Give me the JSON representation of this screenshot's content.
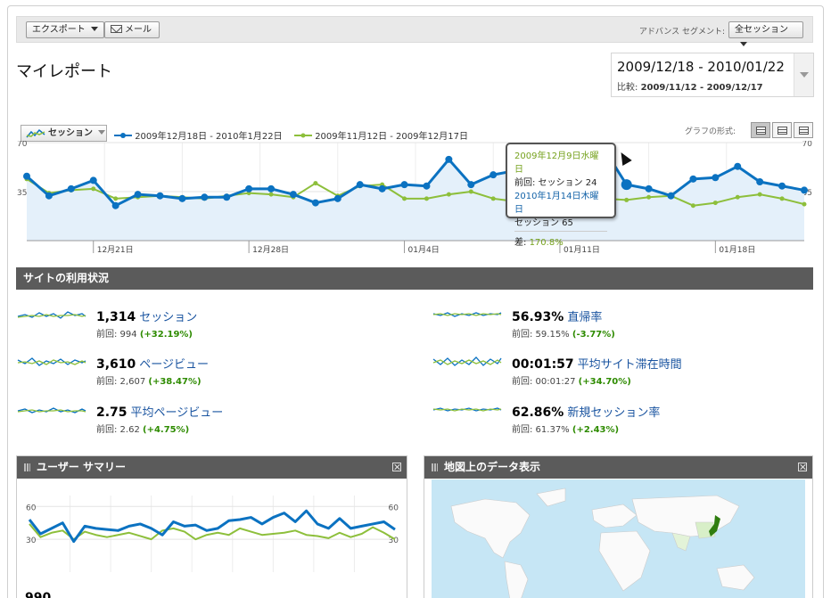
{
  "toolbar": {
    "export_label": "エクスポート",
    "mail_label": "メール",
    "segment_label": "アドバンス セグメント:",
    "segment_value": "全セッション"
  },
  "page_title": "マイレポート",
  "date_range": {
    "main": "2009/12/18 - 2010/01/22",
    "compare_label": "比較:",
    "compare": "2009/11/12 - 2009/12/17"
  },
  "graph": {
    "metric_label": "セッション",
    "legend_current": "2009年12月18日 - 2010年1月22日",
    "legend_previous": "2009年11月12日 - 2009年12月17日",
    "format_label": "グラフの形式:",
    "colors": {
      "current": "#0b72c1",
      "previous": "#8dbf3b",
      "fill": "#e4f0fa"
    }
  },
  "tooltip": {
    "prev_date": "2009年12月9日水曜日",
    "prev_line": "前回: セッション 24",
    "cur_date": "2010年1月14日木曜日",
    "cur_line": "セッション 65",
    "diff_label": "差:",
    "diff_value": "170.8%"
  },
  "chart_data": [
    {
      "type": "line",
      "x": [
        "12/18",
        "12/19",
        "12/20",
        "12/21",
        "12/22",
        "12/23",
        "12/24",
        "12/25",
        "12/26",
        "12/27",
        "12/28",
        "12/29",
        "12/30",
        "12/31",
        "1/1",
        "1/2",
        "1/3",
        "1/4",
        "1/5",
        "1/6",
        "1/7",
        "1/8",
        "1/9",
        "1/10",
        "1/11",
        "1/12",
        "1/13",
        "1/14",
        "1/15",
        "1/16",
        "1/17",
        "1/18",
        "1/19",
        "1/20",
        "1/21",
        "1/22"
      ],
      "series": [
        {
          "name": "2009年12月18日 - 2010年1月22日",
          "values": [
            46,
            32,
            37,
            43,
            25,
            33,
            32,
            30,
            31,
            31,
            37,
            37,
            33,
            27,
            30,
            40,
            37,
            40,
            39,
            58,
            40,
            47,
            50,
            52,
            57,
            58,
            65,
            40,
            37,
            32,
            44,
            45,
            53,
            42,
            39,
            36
          ]
        },
        {
          "name": "2009年11月12日 - 2009年12月17日",
          "values": [
            44,
            34,
            36,
            37,
            30,
            31,
            32,
            31,
            30,
            32,
            34,
            33,
            31,
            41,
            32,
            39,
            40,
            30,
            30,
            33,
            35,
            30,
            28,
            26,
            30,
            30,
            30,
            29,
            31,
            32,
            25,
            27,
            31,
            33,
            30,
            26
          ]
        }
      ],
      "x_tick_labels": [
        "12月21日",
        "12月28日",
        "01月4日",
        "01月11日",
        "01月18日"
      ],
      "y_tick_labels": [
        "70",
        "35"
      ],
      "ylim": [
        0,
        70
      ],
      "grid": true
    },
    {
      "type": "line",
      "series": [
        {
          "values": [
            48,
            35,
            40,
            45,
            28,
            42,
            40,
            39,
            38,
            42,
            44,
            40,
            34,
            46,
            42,
            43,
            38,
            40,
            47,
            48,
            50,
            44,
            50,
            54,
            46,
            56,
            44,
            40,
            49,
            40,
            42,
            44,
            46,
            39
          ]
        },
        {
          "values": [
            44,
            32,
            36,
            38,
            30,
            37,
            34,
            32,
            34,
            36,
            33,
            30,
            38,
            40,
            37,
            30,
            34,
            36,
            34,
            40,
            37,
            34,
            35,
            36,
            38,
            34,
            33,
            31,
            36,
            32,
            35,
            41,
            36,
            30
          ]
        }
      ],
      "y_tick_labels": [
        "60",
        "30"
      ],
      "ylim": [
        0,
        70
      ],
      "grid": true
    }
  ],
  "section_title": "サイトの利用状況",
  "stats": [
    {
      "value": "1,314",
      "label": "セッション",
      "prev_label": "前回: 994",
      "change": "(+32.19%)"
    },
    {
      "value": "3,610",
      "label": "ページビュー",
      "prev_label": "前回: 2,607",
      "change": "(+38.47%)"
    },
    {
      "value": "2.75",
      "label": "平均ページビュー",
      "prev_label": "前回: 2.62",
      "change": "(+4.75%)"
    },
    {
      "value": "56.93%",
      "label": "直帰率",
      "prev_label": "前回: 59.15%",
      "change": "(-3.77%)"
    },
    {
      "value": "00:01:57",
      "label": "平均サイト滞在時間",
      "prev_label": "前回: 00:01:27",
      "change": "(+34.70%)"
    },
    {
      "value": "62.86%",
      "label": "新規セッション率",
      "prev_label": "前回: 61.37%",
      "change": "(+2.43%)"
    }
  ],
  "widgets": {
    "user_summary_title": "ユーザー サマリー",
    "map_title": "地図上のデータ表示",
    "user_value": "990"
  }
}
